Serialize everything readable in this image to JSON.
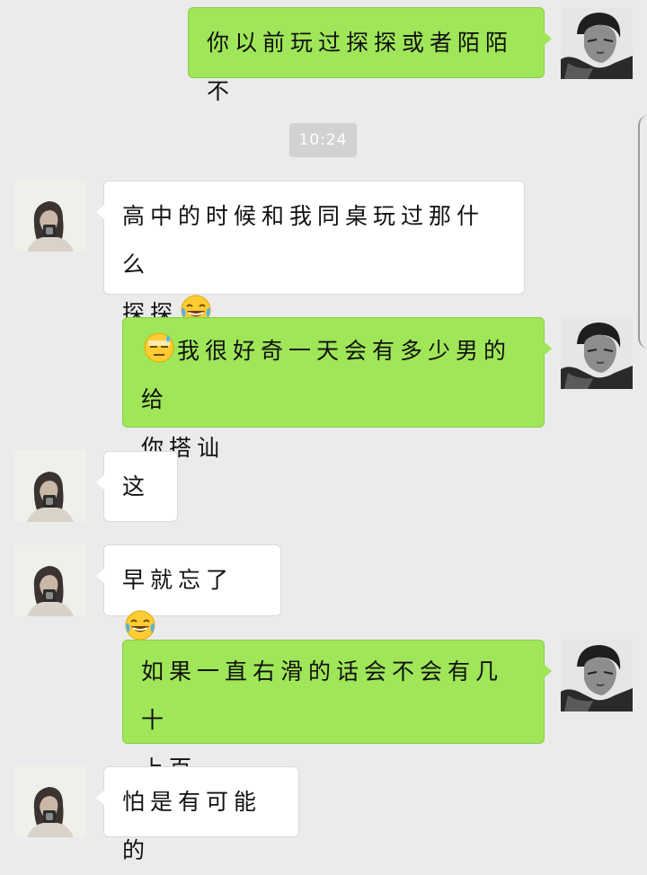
{
  "conversation": {
    "timestamp": "10:24",
    "messages": [
      {
        "side": "self",
        "text": "你以前玩过探探或者陌陌不"
      },
      {
        "side": "other",
        "text_line1": "高中的时候和我同桌玩过那什么",
        "text_line2": "探探",
        "emoji": "tears-of-joy-emoji"
      },
      {
        "side": "self",
        "emoji": "sweat-emoji",
        "text_line1": "我很好奇一天会有多少男的给",
        "text_line2": "你搭讪"
      },
      {
        "side": "other",
        "text": "这"
      },
      {
        "side": "other",
        "text": "早就忘了",
        "emoji": "tears-of-joy-emoji"
      },
      {
        "side": "self",
        "text_line1": "如果一直右滑的话会不会有几十",
        "text_line2": "上百..."
      },
      {
        "side": "other",
        "text": "怕是有可能的"
      }
    ]
  },
  "colors": {
    "background": "#ebebeb",
    "self_bubble": "#9fe658",
    "other_bubble": "#ffffff",
    "timestamp_pill": "#d2d2d2"
  }
}
